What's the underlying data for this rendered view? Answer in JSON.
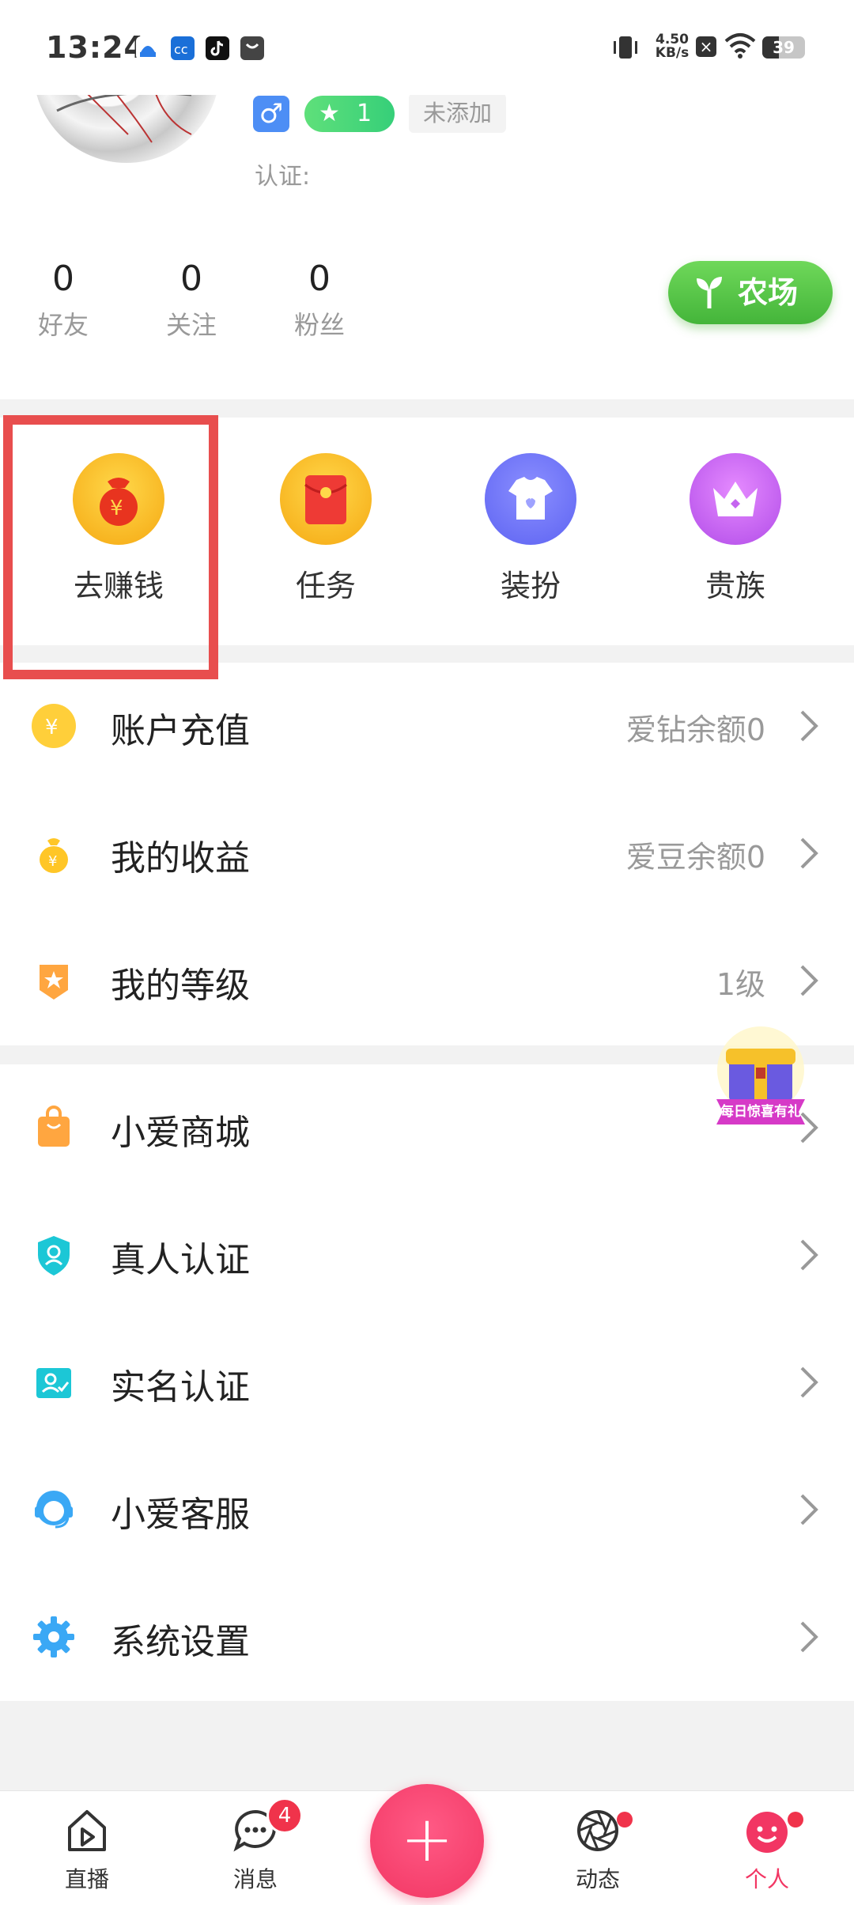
{
  "status_bar": {
    "time": "13:24",
    "net_speed_value": "4.50",
    "net_speed_unit": "KB/s",
    "battery": "39"
  },
  "profile": {
    "gender_symbol": "♂",
    "level": "1",
    "tag": "未添加",
    "cert_label": "认证:",
    "stats": [
      {
        "value": "0",
        "label": "好友"
      },
      {
        "value": "0",
        "label": "关注"
      },
      {
        "value": "0",
        "label": "粉丝"
      }
    ],
    "farm_button": "农场"
  },
  "quick_grid": [
    {
      "label": "去赚钱",
      "icon": "money-bag-icon"
    },
    {
      "label": "任务",
      "icon": "red-envelope-icon"
    },
    {
      "label": "装扮",
      "icon": "tshirt-icon"
    },
    {
      "label": "贵族",
      "icon": "crown-icon"
    }
  ],
  "menu_group_1": [
    {
      "label": "账户充值",
      "value": "爱钻余额0",
      "icon": "yuan-coin-icon"
    },
    {
      "label": "我的收益",
      "value": "爱豆余额0",
      "icon": "money-bag-icon"
    },
    {
      "label": "我的等级",
      "value": "1级",
      "icon": "level-badge-icon"
    }
  ],
  "menu_group_2": [
    {
      "label": "小爱商城",
      "value": "",
      "icon": "shopping-bag-icon"
    },
    {
      "label": "真人认证",
      "value": "",
      "icon": "verified-shield-icon"
    },
    {
      "label": "实名认证",
      "value": "",
      "icon": "id-card-icon"
    },
    {
      "label": "小爱客服",
      "value": "",
      "icon": "customer-service-icon"
    },
    {
      "label": "系统设置",
      "value": "",
      "icon": "gear-icon"
    }
  ],
  "gift_banner": "每日惊喜有礼",
  "bottom_nav": {
    "items": [
      {
        "label": "直播",
        "icon": "live-play-icon"
      },
      {
        "label": "消息",
        "icon": "message-icon",
        "badge": "4"
      },
      {
        "label": "动态",
        "icon": "aperture-icon"
      },
      {
        "label": "个人",
        "icon": "smiley-face-icon"
      }
    ],
    "center_plus": "+"
  },
  "colors": {
    "accent_pink": "#f23663",
    "highlight_red": "#e84e4e",
    "farm_green": "#44b53a"
  }
}
